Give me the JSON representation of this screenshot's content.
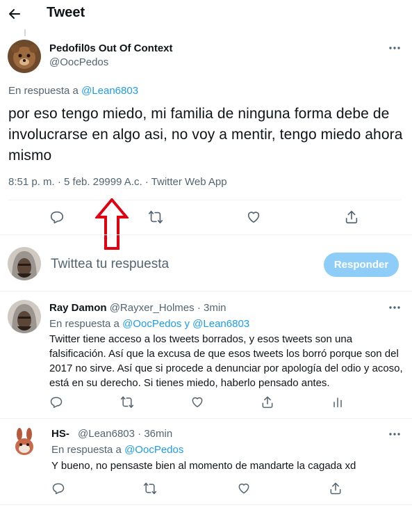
{
  "header": {
    "title": "Tweet",
    "back_icon": "arrow-left-icon"
  },
  "main_tweet": {
    "author_name": "Pedofil0s Out Of Context",
    "handle": "@OocPedos",
    "replying_prefix": "En respuesta a",
    "replying_to": "@Lean6803",
    "text": "por eso tengo miedo, mi familia de ninguna forma debe de involucrarse en algo asi, no voy a mentir, tengo miedo ahora mismo",
    "meta": "8:51 p. m. · 5 feb. 29999 A.c. · Twitter Web App"
  },
  "composer": {
    "placeholder": "Twittea tu respuesta",
    "button": "Responder"
  },
  "replies": [
    {
      "name": "Ray Damon",
      "handle": "@Rayxer_Holmes",
      "time": "· 3min",
      "replying_prefix": "En respuesta a",
      "replying_to": "@OocPedos y @Lean6803",
      "text": "Twitter tiene acceso a los tweets borrados, y esos tweets son una falsificación. Así que la excusa de que esos tweets los borró porque son del 2017 no sirve. Así que si procede a denunciar por apología del odio y acoso, está en su derecho. Si tienes miedo, haberlo pensado antes."
    },
    {
      "name": "HS-",
      "handle": "@Lean6803",
      "time": "· 36min",
      "replying_prefix": "En respuesta a",
      "replying_to": "@OocPedos",
      "text": "Y bueno, no pensaste bien al momento de mandarte la cagada xd"
    }
  ],
  "colors": {
    "accent": "#1d9bf0",
    "annotation_arrow": "#e0000f",
    "button_disabled": "#8ecdf8"
  }
}
